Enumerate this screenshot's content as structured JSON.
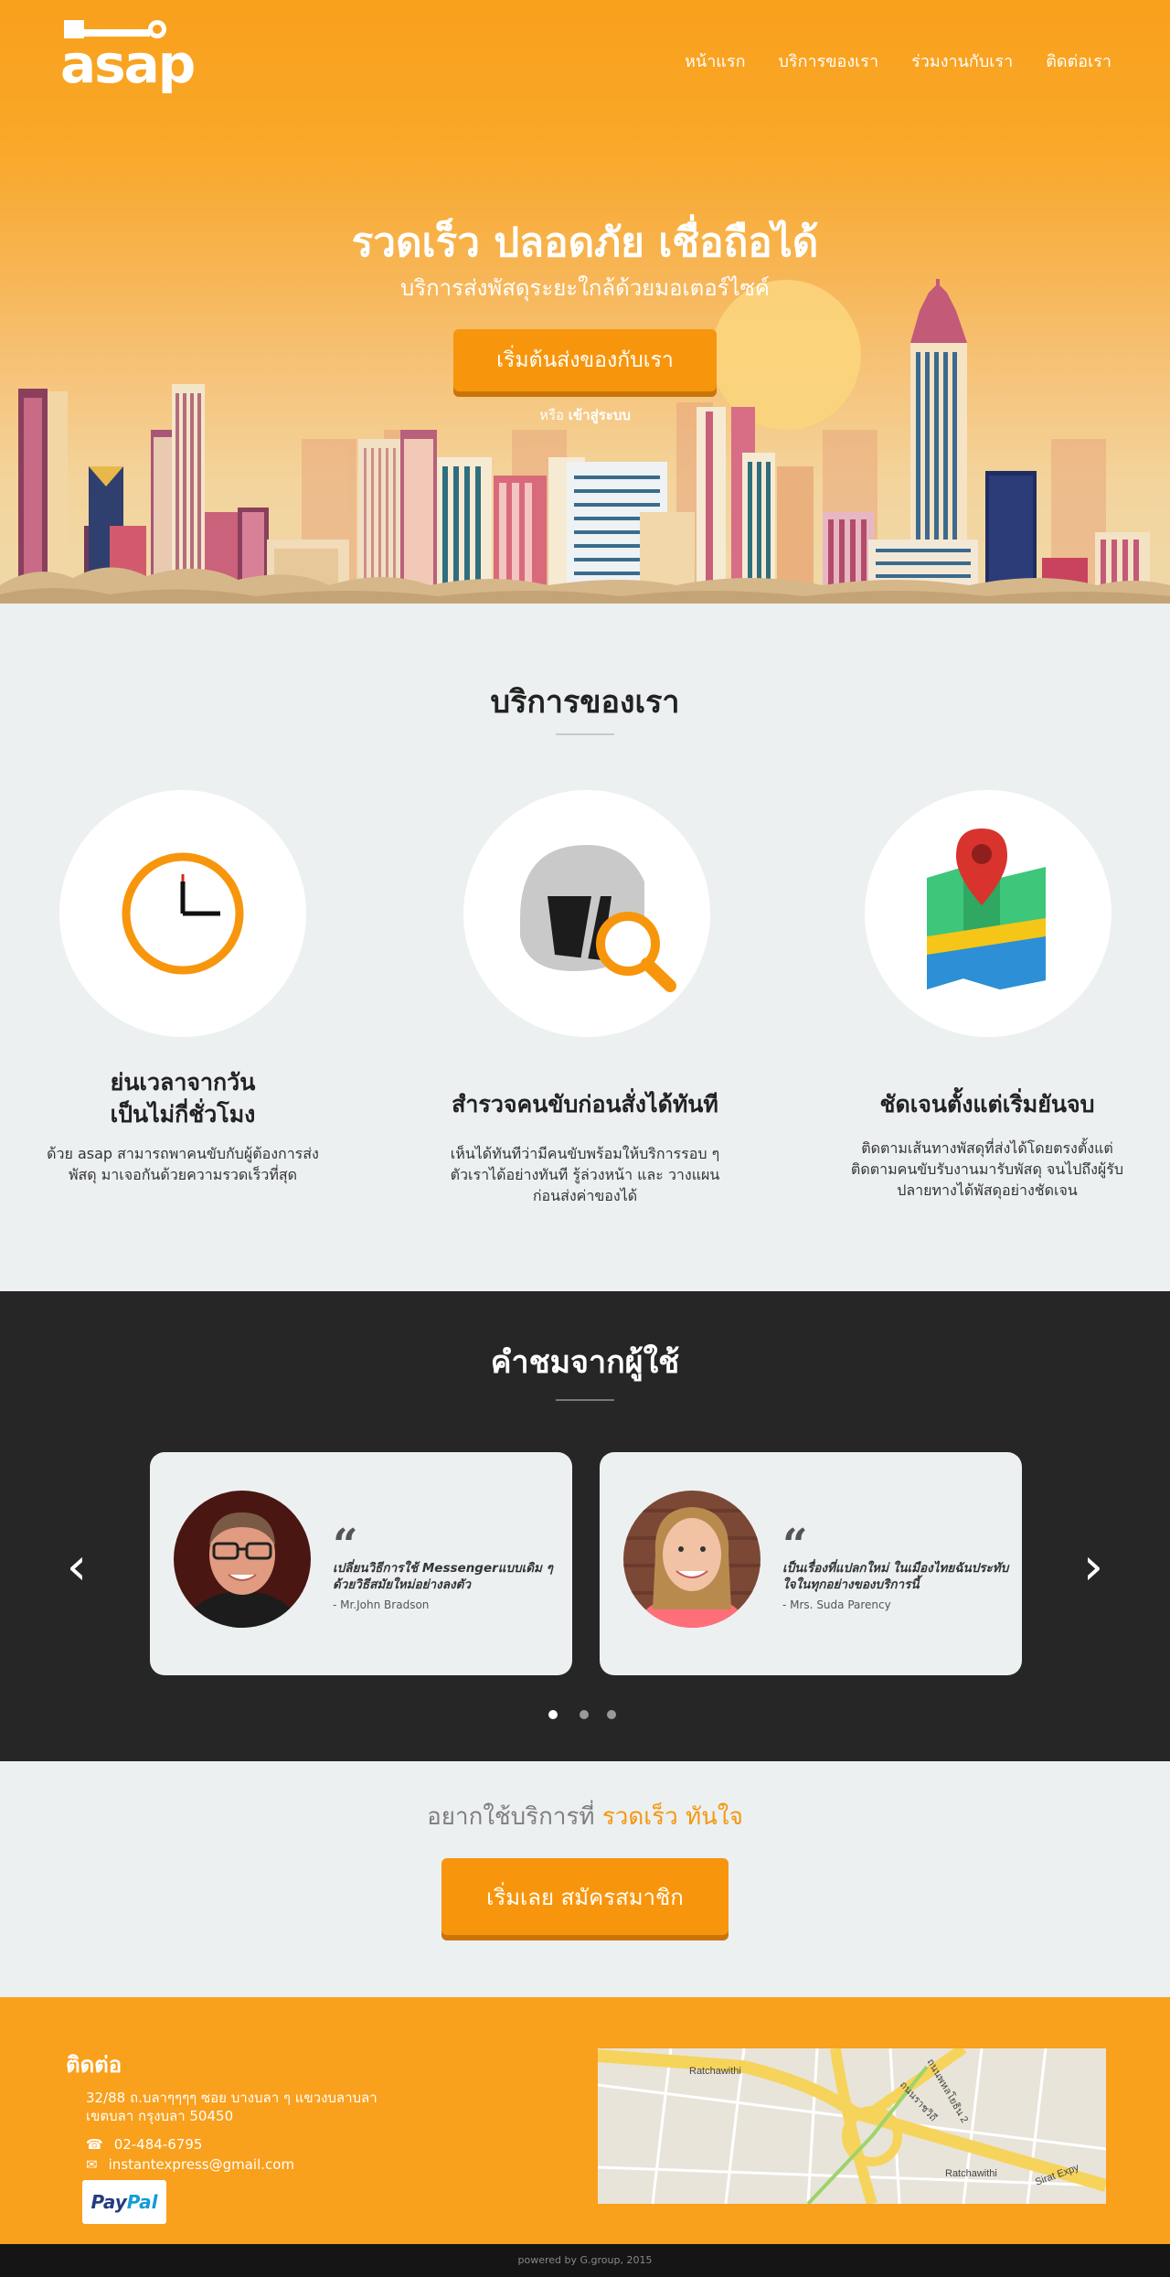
{
  "brand": {
    "logo_text": "asap"
  },
  "nav": [
    {
      "label": "หน้าแรก"
    },
    {
      "label": "บริการของเรา"
    },
    {
      "label": "ร่วมงานกับเรา"
    },
    {
      "label": "ติดต่อเรา"
    }
  ],
  "hero": {
    "title": "รวดเร็ว ปลอดภัย เชื่อถือได้",
    "subtitle": "บริการส่งพัสดุระยะใกล้ด้วยมอเตอร์ไซค์",
    "cta_label": "เริ่มต้นส่งของกับเรา",
    "or_text": "หรือ",
    "login_label": "เข้าสู่ระบบ"
  },
  "services": {
    "title": "บริการของเรา",
    "items": [
      {
        "icon": "clock-icon",
        "heading_line1": "ย่นเวลาจากวัน",
        "heading_line2": "เป็นไม่กี่ชั่วโมง",
        "text": "ด้วย asap สามารถพาคนขับกับผู้ต้องการส่งพัสดุ มาเจอกันด้วยความรวดเร็วที่สุด"
      },
      {
        "icon": "helmet-search-icon",
        "heading_line1": "สำรวจคนขับก่อนสั่งได้ทันที",
        "heading_line2": "",
        "text": "เห็นได้ทันทีว่ามีคนขับพร้อมให้บริการรอบ ๆ ตัวเราได้อย่างทันที รู้ล่วงหน้า และ วางแผนก่อนส่งค่าของได้"
      },
      {
        "icon": "map-pin-icon",
        "heading_line1": "ชัดเจนตั้งแต่เริ่มยันจบ",
        "heading_line2": "",
        "text": "ติดตามเส้นทางพัสดุที่ส่งได้โดยตรงตั้งแต่ติดตามคนขับรับงานมารับพัสดุ จนไปถึงผู้รับปลายทางได้พัสดุอย่างชัดเจน"
      }
    ]
  },
  "testimonials": {
    "title": "คำชมจากผู้ใช้",
    "items": [
      {
        "quote": "เปลี่ยนวิธีการใช้ Messengerแบบเดิม ๆ ด้วยวิธีสมัยใหม่อย่างลงตัว",
        "author": "- Mr.John Bradson"
      },
      {
        "quote": "เป็นเรื่องที่แปลกใหม่ ในเมืองไทยฉันประทับใจในทุกอย่างของบริการนี้",
        "author": "- Mrs. Suda Parency"
      }
    ],
    "prev_label": "‹",
    "next_label": "›"
  },
  "cta": {
    "text_prefix": "อยากใช้บริการที่",
    "text_highlight": "รวดเร็ว ทันใจ",
    "button_label": "เริ่มเลย สมัครสมาชิก"
  },
  "footer": {
    "heading": "ติดต่อ",
    "address_line1": "32/88 ถ.บลาๆๆๆๆ ซอย บางบลา ๆ แขวงบลาบลา",
    "address_line2": "เขตบลา กรุงบลา 50450",
    "phone": "02-484-6795",
    "email": "instantexpress@gmail.com",
    "paypal_pay": "Pay",
    "paypal_pal": "Pal",
    "copyright": "powered by G.group, 2015"
  },
  "map_labels": {
    "road1": "Ratchawithi",
    "road2": "ถนนราชวิถี",
    "road3": "Sirat Expy",
    "road4": "Ratchawithi",
    "road5": "ถนนพหลโยธิน 2"
  },
  "colors": {
    "accent": "#f7960c",
    "dark": "#262626",
    "light": "#ecf0f1"
  }
}
